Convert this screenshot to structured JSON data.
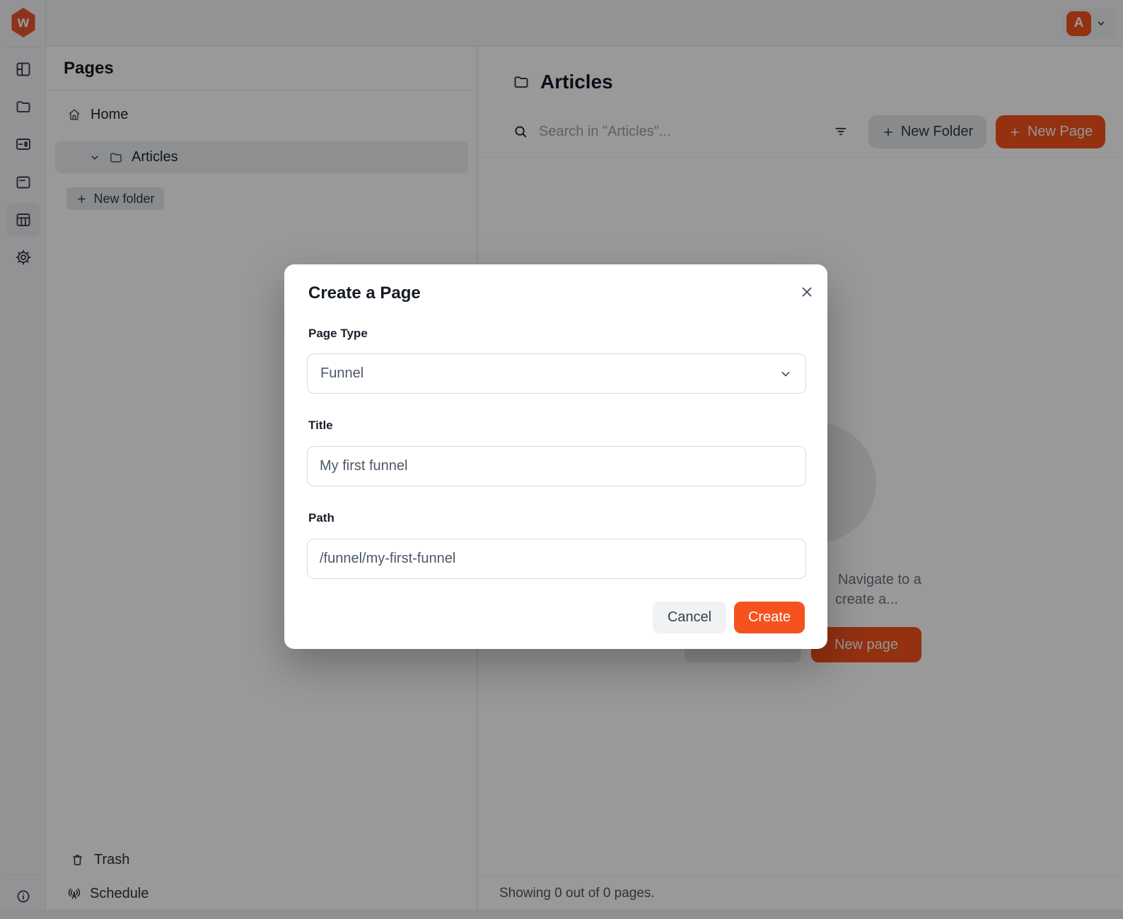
{
  "colors": {
    "accent": "#F5521D",
    "logo": "#E9582E",
    "overlay": "rgba(0,0,0,0.40)"
  },
  "brand": {
    "logo_letter": "w"
  },
  "topbar": {
    "avatar_initial": "A"
  },
  "rail": {
    "icons": [
      "panels-icon",
      "folder-icon",
      "site-icon",
      "article-icon",
      "table-icon",
      "settings-icon",
      "info-icon"
    ],
    "active_icon": "table-icon"
  },
  "pages_panel": {
    "title": "Pages",
    "home_label": "Home",
    "articles_label": "Articles",
    "new_folder_label": "New folder",
    "trash_label": "Trash",
    "schedule_label": "Schedule"
  },
  "main": {
    "title": "Articles",
    "search_placeholder": "Search in \"Articles\"...",
    "new_folder_button": "New Folder",
    "new_page_button": "New Page",
    "empty_line1": "Navigate to a",
    "empty_line2": "create a...",
    "empty_new_page_button": "New page",
    "footer_status": "Showing 0 out of 0 pages."
  },
  "modal": {
    "title": "Create a Page",
    "page_type_label": "Page Type",
    "page_type_value": "Funnel",
    "title_label": "Title",
    "title_value": "My first funnel",
    "path_label": "Path",
    "path_value": "/funnel/my-first-funnel",
    "cancel_label": "Cancel",
    "create_label": "Create"
  },
  "icons_glyphs": {
    "plus": "+",
    "close": "×",
    "chevron_down": "⌄"
  }
}
